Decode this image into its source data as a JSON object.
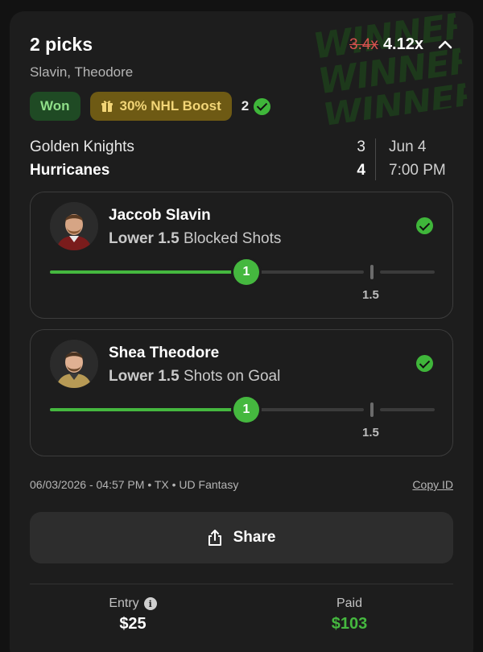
{
  "header": {
    "title": "2 picks",
    "subtitle": "Slavin, Theodore",
    "multiplier_old": "3.4x",
    "multiplier_new": "4.12x",
    "winner_watermark": [
      "WINNER!!",
      "WINNER!!",
      "WINNER!!"
    ]
  },
  "badges": {
    "status": "Won",
    "boost": "30% NHL Boost",
    "pick_count": "2"
  },
  "game": {
    "away_team": "Golden Knights",
    "home_team": "Hurricanes",
    "away_score": "3",
    "home_score": "4",
    "date": "Jun 4",
    "time": "7:00 PM"
  },
  "picks": [
    {
      "player": "Jaccob Slavin",
      "direction": "Lower",
      "line": "1.5",
      "stat": "Blocked Shots",
      "result_value": "1",
      "result_fraction": 0.5,
      "line_label": "1.5",
      "status_icon": "check-circle-icon"
    },
    {
      "player": "Shea Theodore",
      "direction": "Lower",
      "line": "1.5",
      "stat": "Shots on Goal",
      "result_value": "1",
      "result_fraction": 0.5,
      "line_label": "1.5",
      "status_icon": "check-circle-icon"
    }
  ],
  "meta": {
    "timestamp": "06/03/2026 - 04:57 PM • TX • UD Fantasy",
    "copy_id": "Copy ID"
  },
  "actions": {
    "share_label": "Share"
  },
  "footer": {
    "entry_label": "Entry",
    "entry_value": "$25",
    "paid_label": "Paid",
    "paid_value": "$103"
  },
  "colors": {
    "accent_green": "#45b83f",
    "strike_red": "#d9534f",
    "boost_gold": "#f2d577"
  }
}
